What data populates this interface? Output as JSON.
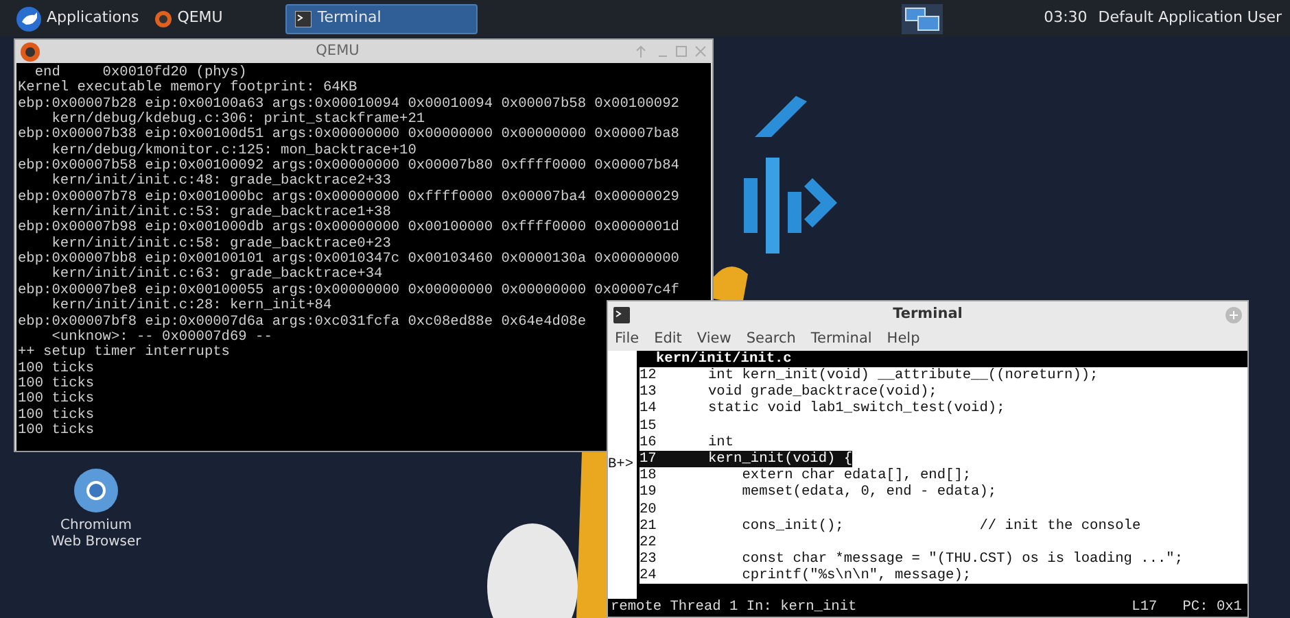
{
  "taskbar": {
    "items": [
      {
        "kind": "menu",
        "label": "Applications",
        "selected": false
      },
      {
        "kind": "task",
        "label": "QEMU",
        "selected": false
      },
      {
        "kind": "task",
        "label": "Terminal",
        "selected": true
      }
    ],
    "clock": "03:30",
    "user": "Default Application User"
  },
  "desktop_icons": [
    {
      "label": "Chromium Web Browser"
    }
  ],
  "qemu_window": {
    "title": "QEMU",
    "lines": [
      "  end     0x0010fd20 (phys)",
      "Kernel executable memory footprint: 64KB",
      "ebp:0x00007b28 eip:0x00100a63 args:0x00010094 0x00010094 0x00007b58 0x00100092",
      "    kern/debug/kdebug.c:306: print_stackframe+21",
      "ebp:0x00007b38 eip:0x00100d51 args:0x00000000 0x00000000 0x00000000 0x00007ba8",
      "    kern/debug/kmonitor.c:125: mon_backtrace+10",
      "ebp:0x00007b58 eip:0x00100092 args:0x00000000 0x00007b80 0xffff0000 0x00007b84",
      "    kern/init/init.c:48: grade_backtrace2+33",
      "ebp:0x00007b78 eip:0x001000bc args:0x00000000 0xffff0000 0x00007ba4 0x00000029",
      "    kern/init/init.c:53: grade_backtrace1+38",
      "ebp:0x00007b98 eip:0x001000db args:0x00000000 0x00100000 0xffff0000 0x0000001d",
      "    kern/init/init.c:58: grade_backtrace0+23",
      "ebp:0x00007bb8 eip:0x00100101 args:0x0010347c 0x00103460 0x0000130a 0x00000000",
      "    kern/init/init.c:63: grade_backtrace+34",
      "ebp:0x00007be8 eip:0x00100055 args:0x00000000 0x00000000 0x00000000 0x00007c4f",
      "    kern/init/init.c:28: kern_init+84",
      "ebp:0x00007bf8 eip:0x00007d6a args:0xc031fcfa 0xc08ed88e 0x64e4d08e",
      "    <unknow>: -- 0x00007d69 --",
      "++ setup timer interrupts",
      "100 ticks",
      "100 ticks",
      "100 ticks",
      "100 ticks",
      "100 ticks"
    ]
  },
  "terminal_window": {
    "title": "Terminal",
    "menu": [
      "File",
      "Edit",
      "View",
      "Search",
      "Terminal",
      "Help"
    ],
    "source_file": "kern/init/init.c",
    "code_lines": [
      {
        "number": "12",
        "code": "int kern_init(void) __attribute__((noreturn));",
        "current": false
      },
      {
        "number": "13",
        "code": "void grade_backtrace(void);",
        "current": false
      },
      {
        "number": "14",
        "code": "static void lab1_switch_test(void);",
        "current": false
      },
      {
        "number": "15",
        "current": false
      },
      {
        "number": "16",
        "code": "int",
        "current": false
      },
      {
        "number": "17",
        "code": "kern_init(void) {",
        "current": true,
        "marker": "B+>"
      },
      {
        "number": "18",
        "code": "    extern char edata[], end[];",
        "current": false
      },
      {
        "number": "19",
        "code": "    memset(edata, 0, end - edata);",
        "current": false
      },
      {
        "number": "20",
        "current": false
      },
      {
        "number": "21",
        "code": "    cons_init();                // init the console",
        "current": false
      },
      {
        "number": "22",
        "current": false
      },
      {
        "number": "23",
        "code": "    const char *message = \"(THU.CST) os is loading ...\";",
        "current": false
      },
      {
        "number": "24",
        "code": "    cprintf(\"%s\\n\\n\", message);",
        "current": false
      }
    ],
    "status_left": "remote Thread 1 In: kern_init",
    "status_right": "L17   PC: 0x1"
  }
}
